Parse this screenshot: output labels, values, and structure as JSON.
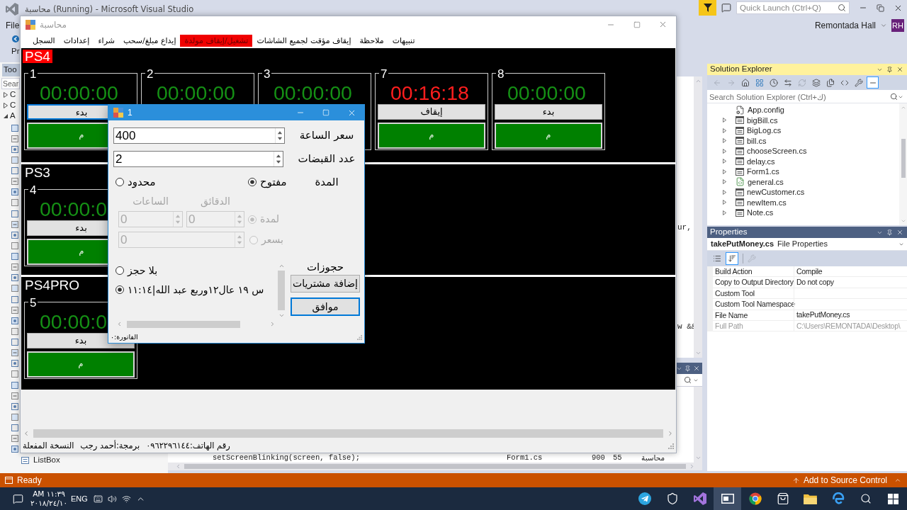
{
  "vs": {
    "title": "محاسبة (Running) - Microsoft Visual Studio",
    "quick_launch": {
      "placeholder": "Quick Launch (Ctrl+Q)"
    },
    "account": {
      "name": "Remontada Hall",
      "initials": "RH"
    },
    "menu": [
      "File"
    ],
    "toolbar_text": "Pr",
    "toolbox": {
      "title": "Too",
      "search": {
        "placeholder": "Sear"
      },
      "groups": [
        {
          "label": "C",
          "expanded": false
        },
        {
          "label": "C",
          "expanded": false
        },
        {
          "label": "A",
          "expanded": true
        }
      ],
      "last_item": "ListBox"
    },
    "editor": {
      "lines": [
        "ur,",
        "w &&"
      ]
    },
    "error_list": {
      "row": {
        "column_1": "setScreenBlinking(screen, false);",
        "column_2": "Form1.cs",
        "column_3": "900",
        "column_4": "55",
        "column_5": "محاسبة"
      }
    },
    "solution_explorer": {
      "title": "Solution Explorer",
      "toolbar": [
        {
          "kind": "back",
          "selected": false
        },
        {
          "kind": "forward",
          "selected": false
        },
        {
          "kind": "home",
          "selected": false
        },
        {
          "kind": "switch-views",
          "selected": false
        },
        {
          "kind": "pending-filter",
          "selected": false
        },
        {
          "kind": "sync",
          "selected": false
        },
        {
          "kind": "refresh",
          "selected": false
        },
        {
          "kind": "collapse",
          "selected": false
        },
        {
          "kind": "show-all",
          "selected": false
        },
        {
          "kind": "view-code",
          "selected": false
        },
        {
          "kind": "properties",
          "selected": false
        },
        {
          "kind": "preview",
          "selected": true
        }
      ],
      "search": {
        "placeholder": "Search Solution Explorer (Ctrl+ك)"
      },
      "items": [
        {
          "name": "App.config",
          "kind": "config"
        },
        {
          "name": "bigBill.cs",
          "kind": "form"
        },
        {
          "name": "BigLog.cs",
          "kind": "form"
        },
        {
          "name": "bill.cs",
          "kind": "form"
        },
        {
          "name": "chooseScreen.cs",
          "kind": "form"
        },
        {
          "name": "delay.cs",
          "kind": "form"
        },
        {
          "name": "Form1.cs",
          "kind": "form"
        },
        {
          "name": "general.cs",
          "kind": "class"
        },
        {
          "name": "newCustomer.cs",
          "kind": "form"
        },
        {
          "name": "newItem.cs",
          "kind": "form"
        },
        {
          "name": "Note.cs",
          "kind": "form"
        }
      ]
    },
    "properties": {
      "title": "Properties",
      "object": "takePutMoney.cs",
      "object_type": "File Properties",
      "view_buttons": [
        {
          "kind": "categorized",
          "selected": false
        },
        {
          "kind": "alphabetical",
          "selected": true
        }
      ],
      "rows": [
        {
          "name": "Build Action",
          "value": "Compile",
          "disabled": false
        },
        {
          "name": "Copy to Output Directory",
          "value": "Do not copy",
          "disabled": false
        },
        {
          "name": "Custom Tool",
          "disabled": false
        },
        {
          "name": "Custom Tool Namespace",
          "disabled": false
        },
        {
          "name": "File Name",
          "value": "takePutMoney.cs",
          "disabled": false
        },
        {
          "name": "Full Path",
          "value": "C:\\Users\\REMONTADA\\Desktop\\",
          "disabled": true
        }
      ]
    },
    "status_bar": {
      "text": "Ready",
      "source_control": "Add to Source Control"
    }
  },
  "app": {
    "title": "محاسبة",
    "menu": [
      {
        "label": "تنبيهات",
        "alert": false
      },
      {
        "label": "ملاحظة",
        "alert": false
      },
      {
        "label": "إيقاف مؤقت لجميع الشاشات",
        "alert": false
      },
      {
        "label": "تشغيل/إيقاف مولدة",
        "alert": true
      },
      {
        "label": "إيداع مبلغ/سحب",
        "alert": false
      },
      {
        "label": "شراء",
        "alert": false
      },
      {
        "label": "إعدادات",
        "alert": false
      },
      {
        "label": "السجل",
        "alert": false
      }
    ],
    "sections": [
      {
        "name": "PS4",
        "highlighted": true,
        "stations": [
          {
            "number": "8",
            "time": "00:00:00",
            "running": false,
            "button": "بدء",
            "focused": false,
            "bill_button": "م"
          },
          {
            "number": "7",
            "time": "00:16:18",
            "running": true,
            "button": "إيقاف",
            "focused": false,
            "bill_button": "م"
          },
          {
            "number": "3",
            "time": "00:00:00",
            "running": false
          },
          {
            "number": "2",
            "time": "00:00:00",
            "running": false
          },
          {
            "number": "1",
            "time": "00:00:00",
            "running": false,
            "button": "بدء",
            "focused": true,
            "bill_button": "م"
          }
        ]
      },
      {
        "name": "PS3",
        "highlighted": false,
        "stations": [
          {
            "number": "4",
            "time": "00:00:0",
            "running": false,
            "button": "بدء",
            "focused": false,
            "bill_button": "م"
          }
        ]
      },
      {
        "name": "PS4PRO",
        "highlighted": false,
        "stations": [
          {
            "number": "5",
            "time": "00:00:0",
            "running": false,
            "button": "بدء",
            "focused": false,
            "bill_button": "م"
          }
        ]
      }
    ],
    "status": [
      "رقم الهاتف:٠٩٦٢٢٩٦١٤٤",
      "برمجة:أحمد رجب",
      "النسخة المفعلة"
    ]
  },
  "dialog": {
    "title": "1",
    "fields": [
      {
        "label": "سعر الساعة",
        "value": "400"
      },
      {
        "label": "عدد القبضات",
        "value": "2"
      }
    ],
    "duration": {
      "label": "المدة",
      "options": [
        {
          "label": "مفتوح",
          "selected": true
        },
        {
          "label": "محدود",
          "selected": false
        }
      ]
    },
    "limit": {
      "disabled": true,
      "hours_label": "الساعات",
      "minutes_label": "الدقائق",
      "hours": "0",
      "minutes": "0",
      "price": "0",
      "options": [
        {
          "label": "لمدة",
          "selected": true
        },
        {
          "label": "بسعر",
          "selected": false
        }
      ]
    },
    "reservations": {
      "label": "حجوزات",
      "items": [
        {
          "label": "بلا حجز",
          "selected": false
        },
        {
          "label": "س ١٩ عال١٢وربع عبد الله|١١:١٤",
          "selected": true
        }
      ]
    },
    "buttons": [
      {
        "label": "إضافة مشتريات",
        "default": false
      },
      {
        "label": "موافق",
        "default": true
      }
    ],
    "status": "الفاتورة:٠"
  },
  "taskbar": {
    "time": "AM ١١:٣٩",
    "date": "٢٠١٨/٢٤/١٠",
    "language": "ENG",
    "apps": [
      {
        "kind": "telegram",
        "selected": false
      },
      {
        "kind": "security",
        "selected": false
      },
      {
        "kind": "visual-studio",
        "selected": false
      },
      {
        "kind": "window",
        "selected": true
      },
      {
        "kind": "browser",
        "selected": false
      },
      {
        "kind": "store",
        "selected": false
      },
      {
        "kind": "files",
        "selected": false
      },
      {
        "kind": "edge",
        "selected": false
      },
      {
        "kind": "search",
        "selected": false
      },
      {
        "kind": "start",
        "selected": false
      }
    ]
  }
}
